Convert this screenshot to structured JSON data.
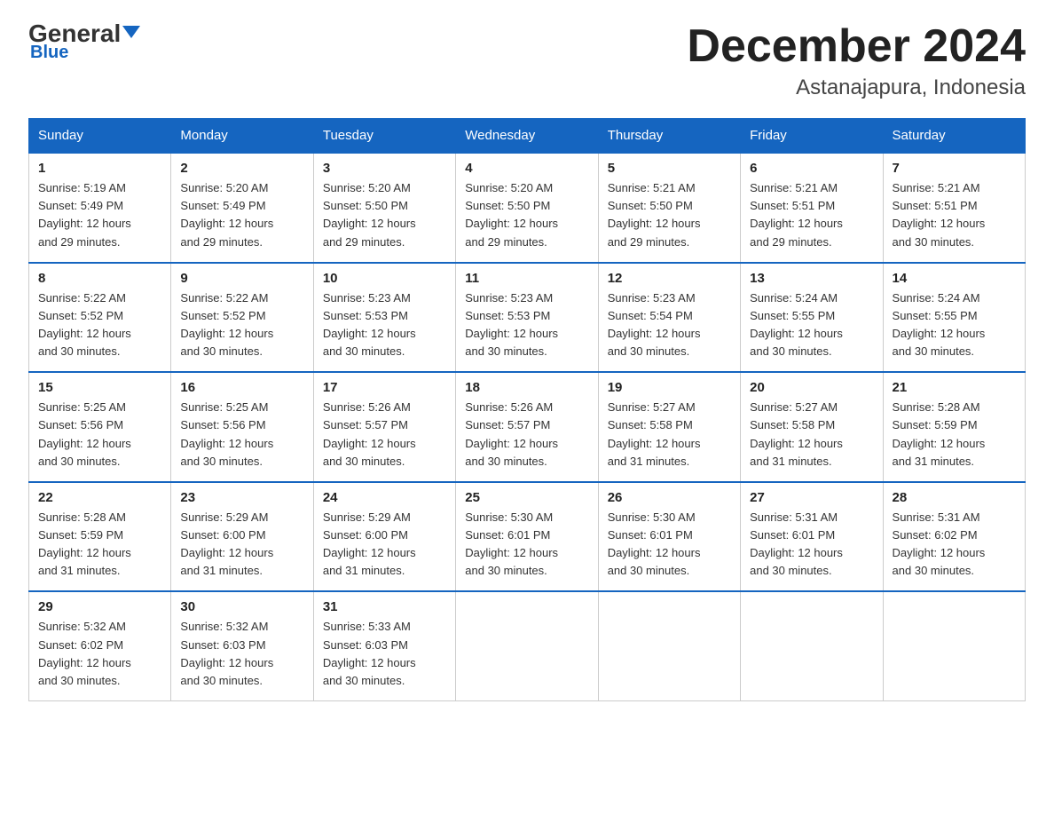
{
  "header": {
    "logo_general": "General",
    "logo_blue": "Blue",
    "month_title": "December 2024",
    "location": "Astanajapura, Indonesia"
  },
  "columns": [
    "Sunday",
    "Monday",
    "Tuesday",
    "Wednesday",
    "Thursday",
    "Friday",
    "Saturday"
  ],
  "weeks": [
    [
      {
        "day": "1",
        "sunrise": "5:19 AM",
        "sunset": "5:49 PM",
        "daylight": "12 hours and 29 minutes."
      },
      {
        "day": "2",
        "sunrise": "5:20 AM",
        "sunset": "5:49 PM",
        "daylight": "12 hours and 29 minutes."
      },
      {
        "day": "3",
        "sunrise": "5:20 AM",
        "sunset": "5:50 PM",
        "daylight": "12 hours and 29 minutes."
      },
      {
        "day": "4",
        "sunrise": "5:20 AM",
        "sunset": "5:50 PM",
        "daylight": "12 hours and 29 minutes."
      },
      {
        "day": "5",
        "sunrise": "5:21 AM",
        "sunset": "5:50 PM",
        "daylight": "12 hours and 29 minutes."
      },
      {
        "day": "6",
        "sunrise": "5:21 AM",
        "sunset": "5:51 PM",
        "daylight": "12 hours and 29 minutes."
      },
      {
        "day": "7",
        "sunrise": "5:21 AM",
        "sunset": "5:51 PM",
        "daylight": "12 hours and 30 minutes."
      }
    ],
    [
      {
        "day": "8",
        "sunrise": "5:22 AM",
        "sunset": "5:52 PM",
        "daylight": "12 hours and 30 minutes."
      },
      {
        "day": "9",
        "sunrise": "5:22 AM",
        "sunset": "5:52 PM",
        "daylight": "12 hours and 30 minutes."
      },
      {
        "day": "10",
        "sunrise": "5:23 AM",
        "sunset": "5:53 PM",
        "daylight": "12 hours and 30 minutes."
      },
      {
        "day": "11",
        "sunrise": "5:23 AM",
        "sunset": "5:53 PM",
        "daylight": "12 hours and 30 minutes."
      },
      {
        "day": "12",
        "sunrise": "5:23 AM",
        "sunset": "5:54 PM",
        "daylight": "12 hours and 30 minutes."
      },
      {
        "day": "13",
        "sunrise": "5:24 AM",
        "sunset": "5:55 PM",
        "daylight": "12 hours and 30 minutes."
      },
      {
        "day": "14",
        "sunrise": "5:24 AM",
        "sunset": "5:55 PM",
        "daylight": "12 hours and 30 minutes."
      }
    ],
    [
      {
        "day": "15",
        "sunrise": "5:25 AM",
        "sunset": "5:56 PM",
        "daylight": "12 hours and 30 minutes."
      },
      {
        "day": "16",
        "sunrise": "5:25 AM",
        "sunset": "5:56 PM",
        "daylight": "12 hours and 30 minutes."
      },
      {
        "day": "17",
        "sunrise": "5:26 AM",
        "sunset": "5:57 PM",
        "daylight": "12 hours and 30 minutes."
      },
      {
        "day": "18",
        "sunrise": "5:26 AM",
        "sunset": "5:57 PM",
        "daylight": "12 hours and 30 minutes."
      },
      {
        "day": "19",
        "sunrise": "5:27 AM",
        "sunset": "5:58 PM",
        "daylight": "12 hours and 31 minutes."
      },
      {
        "day": "20",
        "sunrise": "5:27 AM",
        "sunset": "5:58 PM",
        "daylight": "12 hours and 31 minutes."
      },
      {
        "day": "21",
        "sunrise": "5:28 AM",
        "sunset": "5:59 PM",
        "daylight": "12 hours and 31 minutes."
      }
    ],
    [
      {
        "day": "22",
        "sunrise": "5:28 AM",
        "sunset": "5:59 PM",
        "daylight": "12 hours and 31 minutes."
      },
      {
        "day": "23",
        "sunrise": "5:29 AM",
        "sunset": "6:00 PM",
        "daylight": "12 hours and 31 minutes."
      },
      {
        "day": "24",
        "sunrise": "5:29 AM",
        "sunset": "6:00 PM",
        "daylight": "12 hours and 31 minutes."
      },
      {
        "day": "25",
        "sunrise": "5:30 AM",
        "sunset": "6:01 PM",
        "daylight": "12 hours and 30 minutes."
      },
      {
        "day": "26",
        "sunrise": "5:30 AM",
        "sunset": "6:01 PM",
        "daylight": "12 hours and 30 minutes."
      },
      {
        "day": "27",
        "sunrise": "5:31 AM",
        "sunset": "6:01 PM",
        "daylight": "12 hours and 30 minutes."
      },
      {
        "day": "28",
        "sunrise": "5:31 AM",
        "sunset": "6:02 PM",
        "daylight": "12 hours and 30 minutes."
      }
    ],
    [
      {
        "day": "29",
        "sunrise": "5:32 AM",
        "sunset": "6:02 PM",
        "daylight": "12 hours and 30 minutes."
      },
      {
        "day": "30",
        "sunrise": "5:32 AM",
        "sunset": "6:03 PM",
        "daylight": "12 hours and 30 minutes."
      },
      {
        "day": "31",
        "sunrise": "5:33 AM",
        "sunset": "6:03 PM",
        "daylight": "12 hours and 30 minutes."
      },
      null,
      null,
      null,
      null
    ]
  ],
  "labels": {
    "sunrise": "Sunrise:",
    "sunset": "Sunset:",
    "daylight": "Daylight:"
  }
}
